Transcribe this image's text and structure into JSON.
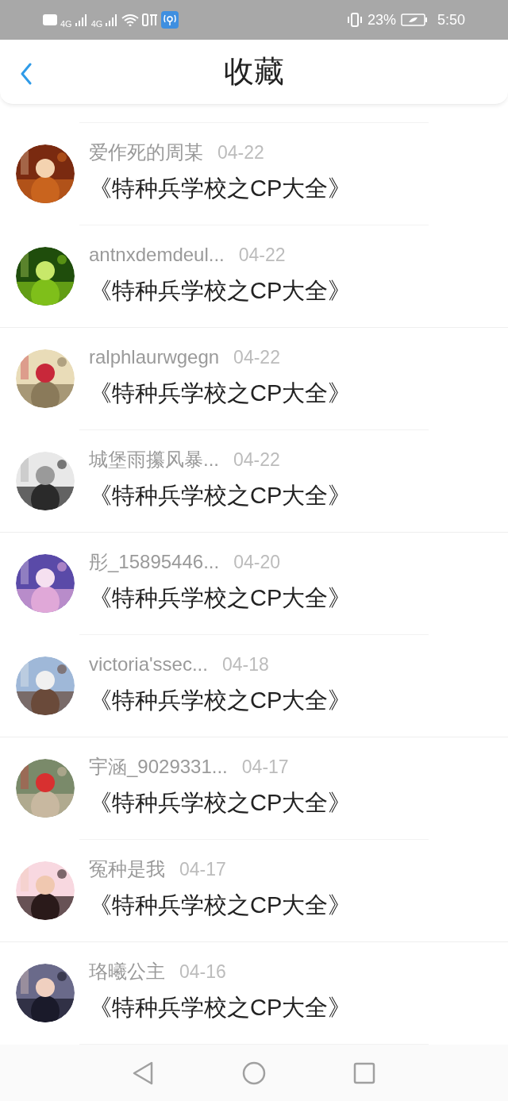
{
  "status_bar": {
    "network_1": "4G",
    "network_2": "4G",
    "battery": "23%",
    "time": "5:50"
  },
  "header": {
    "title": "收藏"
  },
  "items": [
    {
      "name": "爱作死的周某",
      "date": "04-22",
      "title": "《特种兵学校之CP大全》"
    },
    {
      "name": "antnxdemdeul...",
      "date": "04-22",
      "title": "《特种兵学校之CP大全》"
    },
    {
      "name": "ralphlaurwgegn",
      "date": "04-22",
      "title": "《特种兵学校之CP大全》"
    },
    {
      "name": "城堡雨攥风暴...",
      "date": "04-22",
      "title": "《特种兵学校之CP大全》"
    },
    {
      "name": "彤_15895446...",
      "date": "04-20",
      "title": "《特种兵学校之CP大全》"
    },
    {
      "name": "victoria'ssec...",
      "date": "04-18",
      "title": "《特种兵学校之CP大全》"
    },
    {
      "name": "宇涵_9029331...",
      "date": "04-17",
      "title": "《特种兵学校之CP大全》"
    },
    {
      "name": "冤种是我",
      "date": "04-17",
      "title": "《特种兵学校之CP大全》"
    },
    {
      "name": "珞曦公主",
      "date": "04-16",
      "title": "《特种兵学校之CP大全》"
    }
  ]
}
